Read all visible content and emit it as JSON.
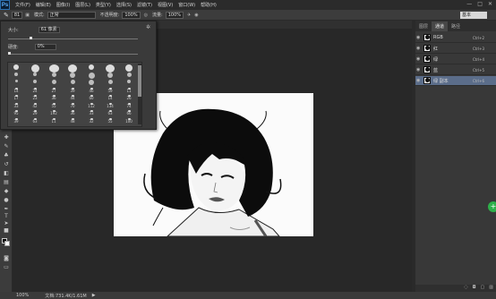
{
  "app": {
    "logo": "Ps"
  },
  "menu": [
    "文件(F)",
    "编辑(E)",
    "图像(I)",
    "图层(L)",
    "类型(Y)",
    "选择(S)",
    "滤镜(T)",
    "视图(V)",
    "窗口(W)",
    "帮助(H)"
  ],
  "window_controls": [
    "—",
    "□",
    "✕"
  ],
  "options_bar": {
    "size_value": "81",
    "mode_label": "模式:",
    "mode_value": "正常",
    "opacity_label": "不透明度:",
    "opacity_value": "100%",
    "flow_label": "流量:",
    "flow_value": "100%",
    "workspace_value": "基本"
  },
  "brush_panel": {
    "size_label": "大小:",
    "size_value": "61 像素",
    "hardness_label": "硬度:",
    "hardness_value": "0%",
    "presets": [
      "",
      "",
      "",
      "",
      "",
      "",
      "",
      "",
      "",
      "",
      "",
      "",
      "",
      "",
      "",
      "",
      "",
      "",
      "",
      "",
      "",
      "14",
      "24",
      "27",
      "39",
      "46",
      "59",
      "11",
      "17",
      "23",
      "36",
      "44",
      "60",
      "14",
      "26",
      "33",
      "42",
      "55",
      "70",
      "112",
      "134",
      "74",
      "95",
      "29",
      "192",
      "36",
      "33",
      "63",
      "66",
      "39",
      "63",
      "11",
      "48",
      "32",
      "55",
      "100"
    ]
  },
  "panel": {
    "tabs": [
      "图层",
      "通道",
      "路径"
    ],
    "active_tab": 1,
    "channels": [
      {
        "name": "RGB",
        "key": "Ctrl+2"
      },
      {
        "name": "红",
        "key": "Ctrl+3"
      },
      {
        "name": "绿",
        "key": "Ctrl+4"
      },
      {
        "name": "蓝",
        "key": "Ctrl+5"
      },
      {
        "name": "绿 副本",
        "key": "Ctrl+6"
      }
    ]
  },
  "status": {
    "zoom": "100%",
    "doc_info": "文档:731.4K/1.61M"
  },
  "colors": {
    "accent_select": "#5b6d8a",
    "ui_bg": "#3c3c3c",
    "canvas_bg": "#282828"
  }
}
